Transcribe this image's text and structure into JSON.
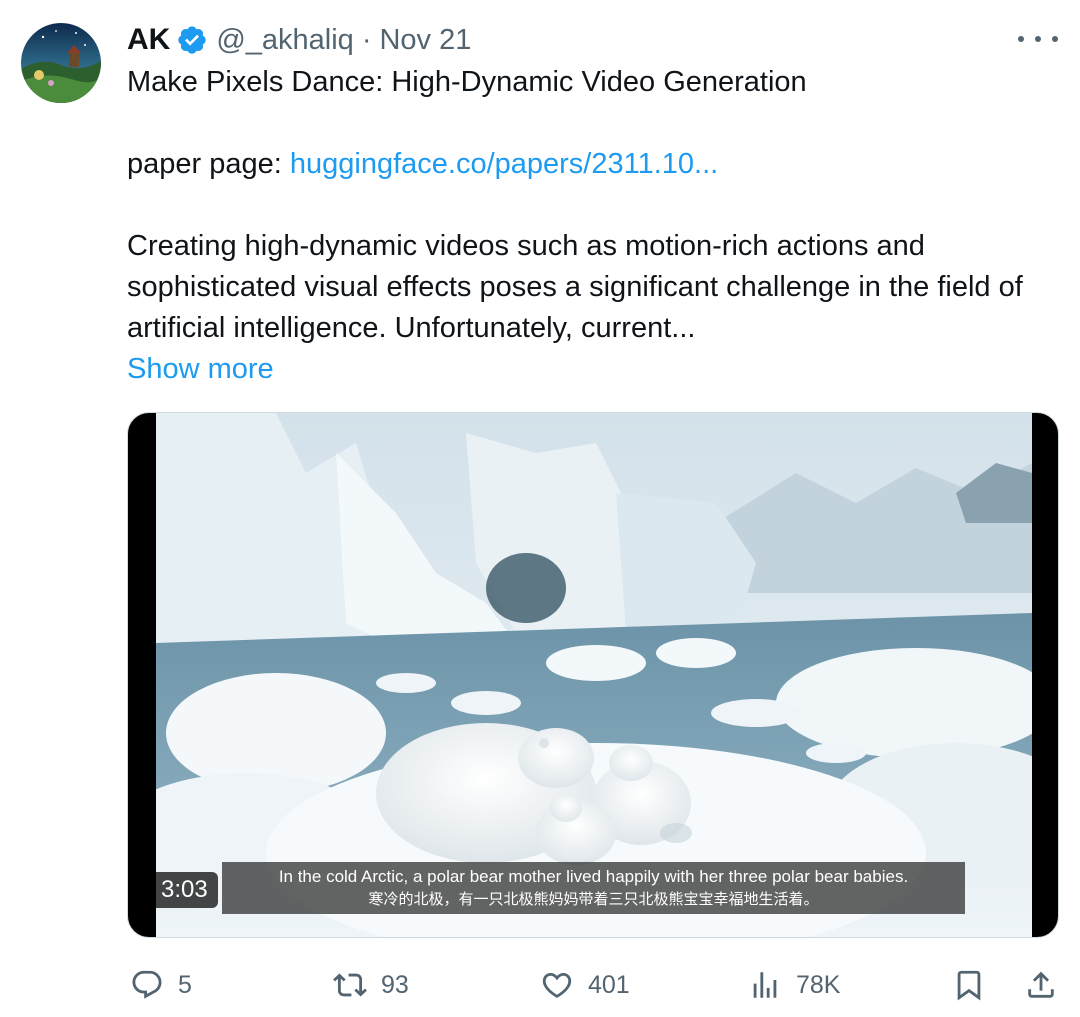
{
  "author": {
    "name": "AK",
    "handle": "@_akhaliq",
    "separator": "·",
    "date": "Nov 21"
  },
  "tweet": {
    "title": "Make Pixels Dance: High-Dynamic Video Generation",
    "paper_label": "paper page: ",
    "paper_link": "huggingface.co/papers/2311.10...",
    "body": "Creating high-dynamic videos such as motion-rich actions and sophisticated visual effects poses a significant challenge in the field of artificial intelligence. Unfortunately, current...",
    "show_more": "Show more"
  },
  "video": {
    "duration": "3:03",
    "subtitle_en": "In the cold Arctic, a polar bear mother lived happily with her three polar bear babies.",
    "subtitle_zh": "寒冷的北极，有一只北极熊妈妈带着三只北极熊宝宝幸福地生活着。"
  },
  "actions": {
    "replies": "5",
    "reposts": "93",
    "likes": "401",
    "views": "78K"
  },
  "icons": {
    "verified": "verified-badge-icon",
    "more": "more-dots-icon",
    "reply": "reply-icon",
    "repost": "repost-icon",
    "like": "heart-icon",
    "views": "views-chart-icon",
    "bookmark": "bookmark-icon",
    "share": "share-icon"
  },
  "colors": {
    "accent": "#1d9bf0",
    "text": "#0f1419",
    "secondary": "#536471"
  }
}
